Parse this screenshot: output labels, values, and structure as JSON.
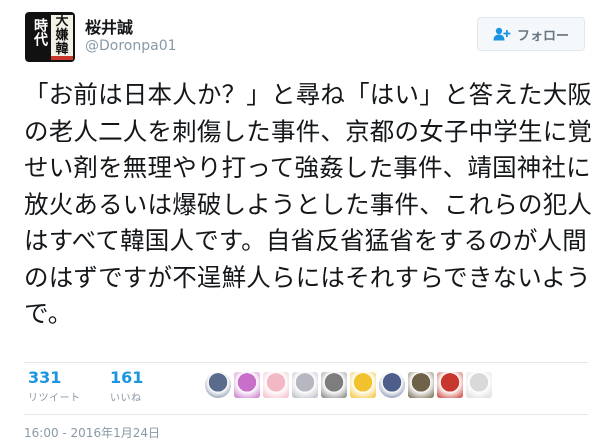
{
  "user": {
    "display_name": "桜井誠",
    "handle": "@Doronpa01",
    "avatar_text_left": "時代",
    "avatar_text_right": "大嫌韓"
  },
  "follow_button": {
    "label": "フォロー",
    "icon": "add-user-icon"
  },
  "tweet": {
    "text": "「お前は日本人か？」と尋ね「はい」と答えた大阪の老人二人を刺傷した事件、京都の女子中学生に覚せい剤を無理やり打って強姦した事件、靖国神社に放火あるいは爆破しようとした事件、これらの犯人はすべて韓国人です。自省反省猛省をするのが人間のはずですが不逞鮮人らにはそれすらできないようで。"
  },
  "stats": {
    "retweets": {
      "count": "331",
      "label": "リツイート"
    },
    "likes": {
      "count": "161",
      "label": "いいね"
    }
  },
  "likers": [
    {
      "name": "liker-avatar",
      "color": "#5a6b8c"
    },
    {
      "name": "liker-avatar",
      "color": "#c86fc9"
    },
    {
      "name": "liker-avatar",
      "color": "#f2b8c6"
    },
    {
      "name": "liker-avatar",
      "color": "#b7b7c2"
    },
    {
      "name": "liker-avatar",
      "color": "#7d7d7d"
    },
    {
      "name": "liker-avatar",
      "color": "#f2c12e"
    },
    {
      "name": "liker-avatar",
      "color": "#4d5e8a"
    },
    {
      "name": "liker-avatar",
      "color": "#6e6248"
    },
    {
      "name": "liker-avatar",
      "color": "#c8372d"
    },
    {
      "name": "liker-avatar",
      "color": "#d9d9d9"
    }
  ],
  "timestamp": "16:00 - 2016年1月24日"
}
